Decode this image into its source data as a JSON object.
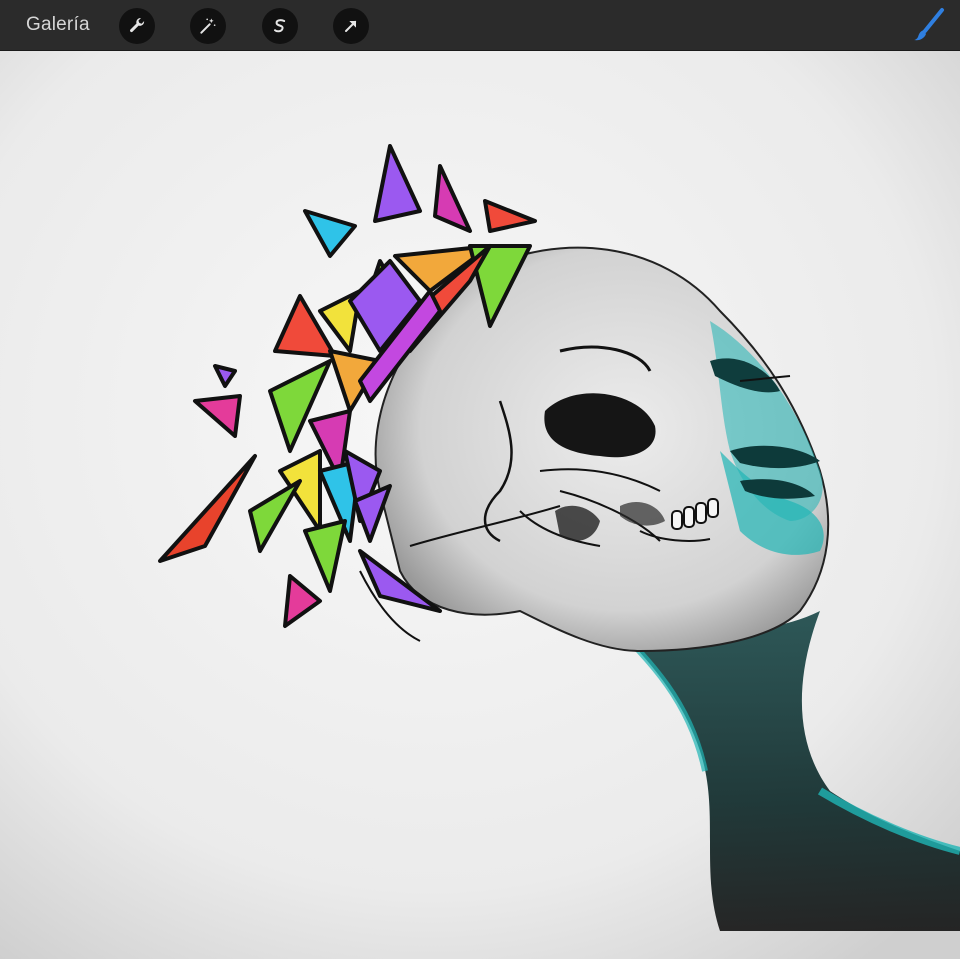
{
  "toolbar": {
    "gallery_label": "Galería",
    "tools": [
      {
        "icon": "wrench-icon"
      },
      {
        "icon": "magic-wand-icon"
      },
      {
        "icon": "selection-icon"
      },
      {
        "icon": "transform-arrow-icon"
      }
    ],
    "brush_icon": "brush-icon",
    "accent_color": "#2f7fe0"
  },
  "canvas": {
    "description_colors": {
      "paper": "#ececec",
      "teal": "#1fb5b5",
      "ink": "#111111"
    }
  }
}
